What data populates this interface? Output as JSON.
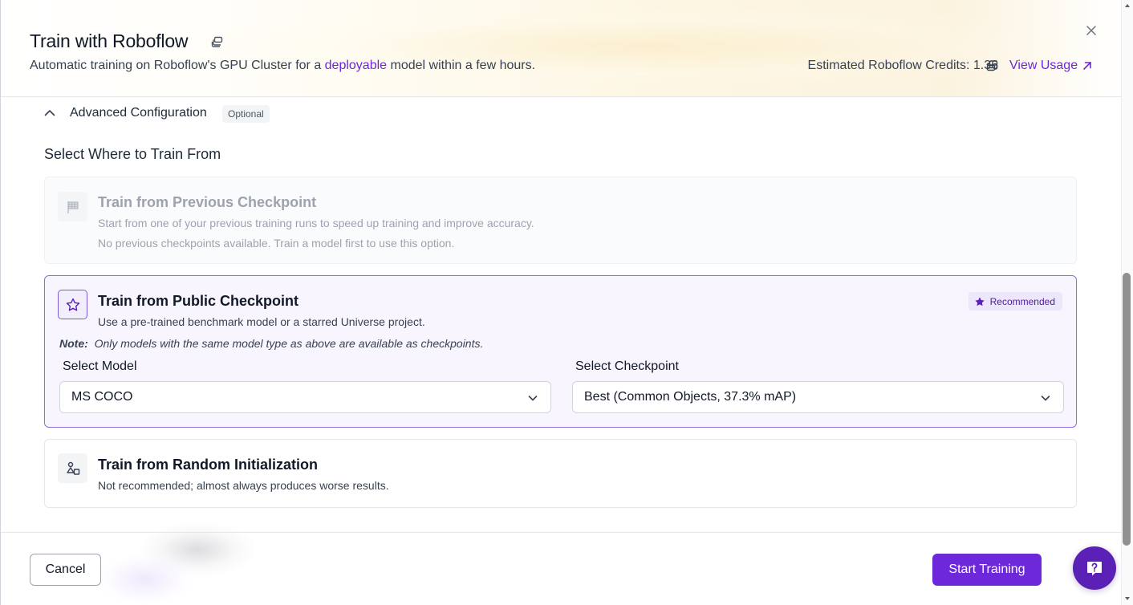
{
  "header": {
    "title": "Train with Roboflow",
    "subtitle_pre": "Automatic training on Roboflow's GPU Cluster for a ",
    "subtitle_link": "deployable",
    "subtitle_post": " model within a few hours.",
    "credits_label": "Estimated Roboflow Credits: 1.36",
    "view_usage": "View Usage"
  },
  "advanced": {
    "label": "Advanced Configuration",
    "badge": "Optional"
  },
  "section_title": "Select Where to Train From",
  "options": {
    "previous": {
      "title": "Train from Previous Checkpoint",
      "desc": "Start from one of your previous training runs to speed up training and improve accuracy.",
      "desc2": "No previous checkpoints available. Train a model first to use this option."
    },
    "public": {
      "title": "Train from Public Checkpoint",
      "desc": "Use a pre-trained benchmark model or a starred Universe project.",
      "badge": "Recommended",
      "note_label": "Note:",
      "note_text": "Only models with the same model type as above are available as checkpoints.",
      "model_label": "Select Model",
      "model_value": "MS COCO",
      "checkpoint_label": "Select Checkpoint",
      "checkpoint_value": "Best (Common Objects, 37.3% mAP)"
    },
    "random": {
      "title": "Train from Random Initialization",
      "desc": "Not recommended; almost always produces worse results."
    }
  },
  "footer": {
    "cancel": "Cancel",
    "start": "Start Training"
  },
  "colors": {
    "accent": "#6d28d9",
    "selected_border": "#8b6fd8",
    "selected_bg": "#f8f5fe"
  },
  "icons": {
    "title_icon": "copy-stack-icon",
    "credits_icon": "coins-icon",
    "view_usage_icon": "arrow-up-right-icon",
    "close": "close-icon",
    "advanced_toggle": "chevron-up-icon",
    "previous": "flag-icon",
    "public": "star-icon",
    "random": "shapes-icon",
    "recommended": "star-filled-icon",
    "select": "chevron-down-icon",
    "help": "help-chat-icon"
  }
}
